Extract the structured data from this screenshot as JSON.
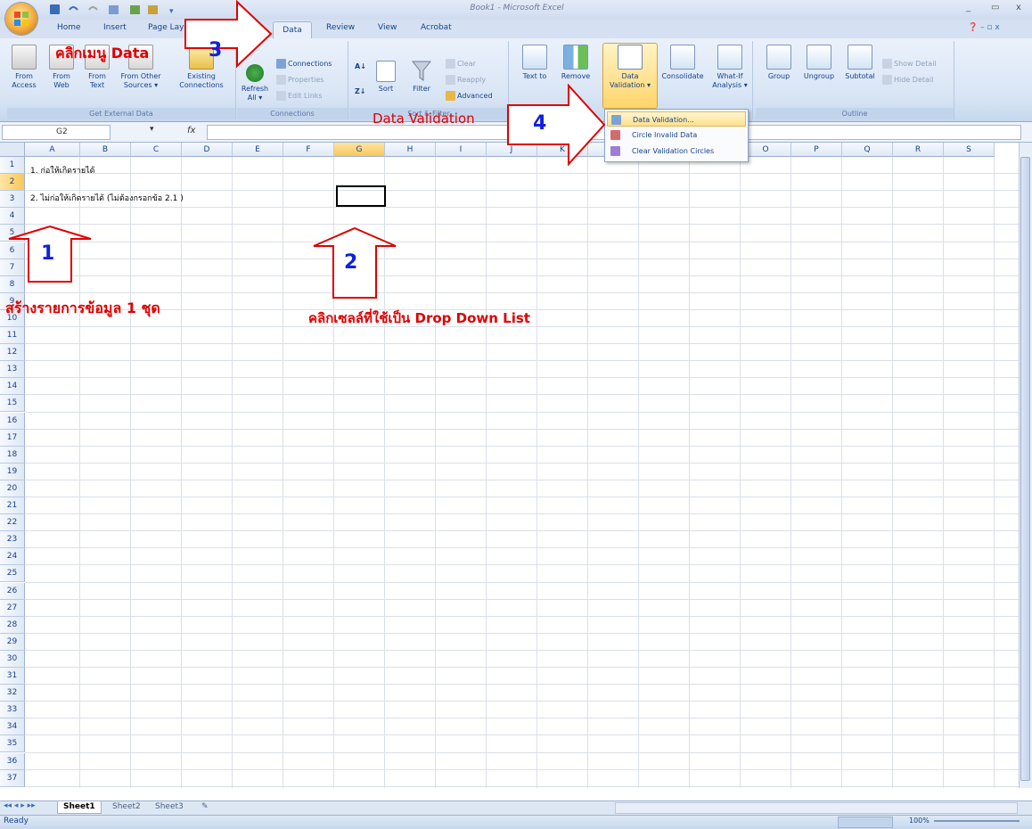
{
  "window": {
    "title": "Book1 - Microsoft Excel",
    "controls": [
      "_",
      "▭",
      "x"
    ]
  },
  "tabs": [
    "Home",
    "Insert",
    "Page Layout",
    "Data",
    "Review",
    "View",
    "Acrobat"
  ],
  "ribbon": {
    "get_external_data": {
      "caption": "Get External Data",
      "buttons": [
        {
          "label": "From Access",
          "l1": "From",
          "l2": "Access"
        },
        {
          "label": "From Web",
          "l1": "From",
          "l2": "Web"
        },
        {
          "label": "From Text",
          "l1": "From",
          "l2": "Text"
        },
        {
          "label": "From Other Sources",
          "l1": "From Other",
          "l2": "Sources ▾"
        },
        {
          "label": "Existing Connections",
          "l1": "Existing",
          "l2": "Connections"
        }
      ]
    },
    "connections": {
      "caption": "Connections",
      "refresh_l1": "Refresh",
      "refresh_l2": "All ▾",
      "connections": "Connections",
      "properties": "Properties",
      "edit_links": "Edit Links"
    },
    "sort_filter": {
      "caption": "Sort & Filter",
      "sort": "Sort",
      "filter": "Filter",
      "clear": "Clear",
      "reapply": "Reapply",
      "advanced": "Advanced"
    },
    "data_tools": {
      "text_to": "Text to",
      "remove": "Remove",
      "data_validation_l1": "Data",
      "data_validation_l2": "Validation ▾",
      "consolidate": "Consolidate",
      "what_if_l1": "What-If",
      "what_if_l2": "Analysis ▾"
    },
    "outline": {
      "caption": "Outline",
      "group": "Group",
      "ungroup": "Ungroup",
      "subtotal": "Subtotal",
      "show_detail": "Show Detail",
      "hide_detail": "Hide Detail"
    }
  },
  "formula_bar": {
    "name_box": "G2",
    "fx": "fx",
    "value": ""
  },
  "columns": [
    "A",
    "B",
    "C",
    "D",
    "E",
    "F",
    "G",
    "H",
    "I",
    "J",
    "K",
    "L",
    "M",
    "N",
    "O",
    "P",
    "Q",
    "R",
    "S"
  ],
  "rows": [
    "1",
    "2",
    "3",
    "4",
    "5",
    "6",
    "7",
    "8",
    "9",
    "10",
    "11",
    "12",
    "13",
    "14",
    "15",
    "16",
    "17",
    "18",
    "19",
    "20",
    "21",
    "22",
    "23",
    "24",
    "25",
    "26",
    "27",
    "28",
    "29",
    "30",
    "31",
    "32",
    "33",
    "34",
    "35",
    "36",
    "37"
  ],
  "cells": {
    "A1": "1. ก่อให้เกิดรายได้",
    "A2": "2. ไม่ก่อให้เกิดรายได้ (ไม่ต้องกรอกข้อ 2.1 )"
  },
  "selected_cell": "G2",
  "dropdown_menu": {
    "items": [
      "Data Validation...",
      "Circle Invalid Data",
      "Clear Validation Circles"
    ],
    "highlighted": "Data Validation..."
  },
  "sheets": [
    "Sheet1",
    "Sheet2",
    "Sheet3"
  ],
  "active_sheet": "Sheet1",
  "status": {
    "left": "Ready",
    "zoom": "100%"
  },
  "annotations": {
    "step1_number": "1",
    "step1_text": "สร้างรายการข้อมูล 1 ชุด",
    "step2_number": "2",
    "step2_text": "คลิกเซลล์ที่ใช้เป็น Drop Down List",
    "step3_number": "3",
    "step3_text": "คลิกเมนู Data",
    "step4_number": "4",
    "step4_text": "Data Validation"
  },
  "colors": {
    "annotation_red": "#e00000",
    "annotation_blue": "#1020e0",
    "ribbon_blue": "#15428b"
  }
}
